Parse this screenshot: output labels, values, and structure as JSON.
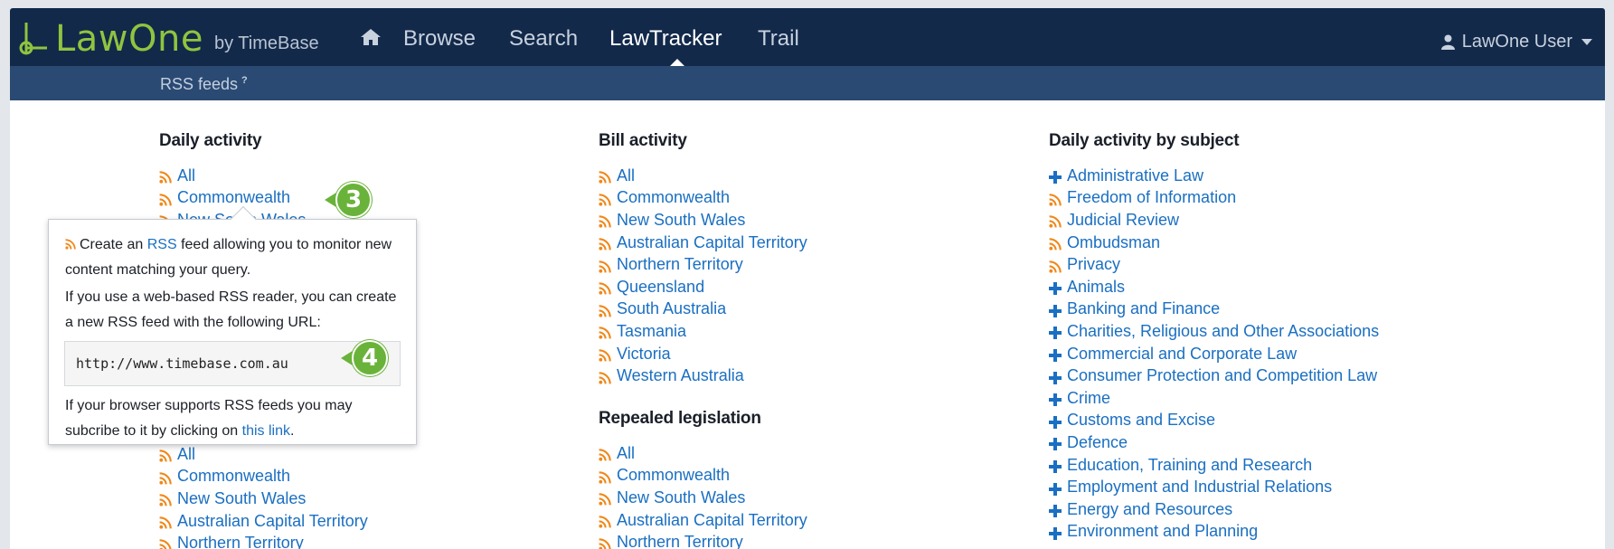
{
  "navbar": {
    "logo_text": "LawOne",
    "logo_by": "by TimeBase",
    "links": [
      {
        "label": "Browse"
      },
      {
        "label": "Search"
      },
      {
        "label": "LawTracker"
      },
      {
        "label": "Trail"
      }
    ],
    "user_label": "LawOne User"
  },
  "subbar": {
    "label": "RSS feeds",
    "help": "?"
  },
  "columns": [
    {
      "sections": [
        {
          "title": "Daily activity",
          "items": [
            {
              "label": "All",
              "icon": "rss"
            },
            {
              "label": "Commonwealth",
              "icon": "rss"
            },
            {
              "label": "New South Wales",
              "icon": "rss"
            }
          ]
        },
        {
          "items": [
            {
              "label": "All",
              "icon": "rss"
            },
            {
              "label": "Commonwealth",
              "icon": "rss"
            },
            {
              "label": "New South Wales",
              "icon": "rss"
            },
            {
              "label": "Australian Capital Territory",
              "icon": "rss"
            },
            {
              "label": "Northern Territory",
              "icon": "rss"
            }
          ]
        }
      ]
    },
    {
      "sections": [
        {
          "title": "Bill activity",
          "items": [
            {
              "label": "All",
              "icon": "rss"
            },
            {
              "label": "Commonwealth",
              "icon": "rss"
            },
            {
              "label": "New South Wales",
              "icon": "rss"
            },
            {
              "label": "Australian Capital Territory",
              "icon": "rss"
            },
            {
              "label": "Northern Territory",
              "icon": "rss"
            },
            {
              "label": "Queensland",
              "icon": "rss"
            },
            {
              "label": "South Australia",
              "icon": "rss"
            },
            {
              "label": "Tasmania",
              "icon": "rss"
            },
            {
              "label": "Victoria",
              "icon": "rss"
            },
            {
              "label": "Western Australia",
              "icon": "rss"
            }
          ]
        },
        {
          "title": "Repealed legislation",
          "items": [
            {
              "label": "All",
              "icon": "rss"
            },
            {
              "label": "Commonwealth",
              "icon": "rss"
            },
            {
              "label": "New South Wales",
              "icon": "rss"
            },
            {
              "label": "Australian Capital Territory",
              "icon": "rss"
            },
            {
              "label": "Northern Territory",
              "icon": "rss"
            }
          ]
        }
      ]
    },
    {
      "sections": [
        {
          "title": "Daily activity by subject",
          "items": [
            {
              "label": "Administrative Law",
              "icon": "plus"
            },
            {
              "label": "Freedom of Information",
              "icon": "rss"
            },
            {
              "label": "Judicial Review",
              "icon": "rss"
            },
            {
              "label": "Ombudsman",
              "icon": "rss"
            },
            {
              "label": "Privacy",
              "icon": "rss"
            },
            {
              "label": "Animals",
              "icon": "plus"
            },
            {
              "label": "Banking and Finance",
              "icon": "plus"
            },
            {
              "label": "Charities, Religious and Other Associations",
              "icon": "plus"
            },
            {
              "label": "Commercial and Corporate Law",
              "icon": "plus"
            },
            {
              "label": "Consumer Protection and Competition Law",
              "icon": "plus"
            },
            {
              "label": "Crime",
              "icon": "plus"
            },
            {
              "label": "Customs and Excise",
              "icon": "plus"
            },
            {
              "label": "Defence",
              "icon": "plus"
            },
            {
              "label": "Education, Training and Research",
              "icon": "plus"
            },
            {
              "label": "Employment and Industrial Relations",
              "icon": "plus"
            },
            {
              "label": "Energy and Resources",
              "icon": "plus"
            },
            {
              "label": "Environment and Planning",
              "icon": "plus"
            }
          ]
        }
      ]
    }
  ],
  "popover": {
    "line1_pre": "Create an",
    "line1_link": "RSS",
    "line1_post": "feed allowing you to monitor new content matching your query.",
    "line2": "If you use a web-based RSS reader, you can create a new RSS feed with the following URL:",
    "url": "http://www.timebase.com.au",
    "line3_pre": "If your browser supports RSS feeds you may subcribe to it by clicking on",
    "line3_link": "this link",
    "line3_post": "."
  },
  "badges": [
    "3",
    "4"
  ],
  "colors": {
    "navbar": "#12294a",
    "subbar": "#2a4a73",
    "brand_green": "#8fc43f",
    "link": "#1a6fc2",
    "rss": "#f0881a",
    "badge": "#6ab33a"
  },
  "icons": {
    "logo": "lawone-mark-icon",
    "home": "home-icon",
    "user": "user-icon",
    "rss": "rss-icon",
    "plus": "plus-icon"
  }
}
